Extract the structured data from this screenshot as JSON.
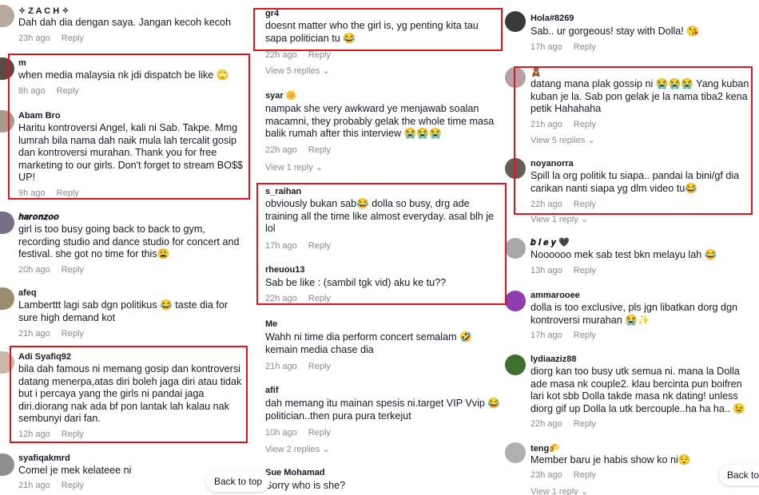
{
  "left": [
    {
      "user": "✧ Z A C H ✧",
      "text": "Dah dah dia dengan saya. Jangan kecoh kecoh",
      "time": "23h ago",
      "reply": "Reply"
    },
    {
      "user": "m",
      "text": "when media malaysia nk jdi dispatch be like 🙄",
      "time": "8h ago",
      "reply": "Reply"
    },
    {
      "user": "Abam Bro",
      "text": "Haritu kontroversi Angel, kali ni Sab. Takpe. Mmg lumrah bila nama dah naik mula lah tercalit gosip dan kontroversi murahan. Thank you for free marketing to our girls. Don't forget to stream BO$$ UP!",
      "time": "9h ago",
      "reply": "Reply"
    },
    {
      "user": "𝒉𝒂𝒓𝒐𝒏𝒛𝒐𝒐",
      "text": "girl is too busy going back to back to gym, recording studio and dance studio for concert and festival. she got no time for this😩",
      "time": "20h ago",
      "reply": "Reply"
    },
    {
      "user": "afeq",
      "text": "Lamberttt lagi sab dgn politikus 😂 taste dia for sure high demand kot",
      "time": "21h ago",
      "reply": "Reply"
    },
    {
      "user": "Adi Syafiq92",
      "text": "bila dah famous ni memang gosip dan kontroversi datang menerpa,atas diri boleh jaga diri atau tidak but i percaya yang the girls ni pandai jaga diri.diorang nak ada bf pon lantak lah kalau nak sembunyi dari fan.",
      "time": "12h ago",
      "reply": "Reply"
    },
    {
      "user": "syafiqakmrd",
      "text": "Comel je mek kelateee ni",
      "time": "21h ago",
      "reply": "Reply"
    }
  ],
  "middle": [
    {
      "user": "gr4",
      "text": "doesnt matter who the girl is, yg penting kita tau sapa politician tu 😂",
      "time": "22h ago",
      "reply": "Reply",
      "more": "View 5 replies"
    },
    {
      "user": "syar 🌼",
      "text": "nampak she very awkward ye menjawab soalan macamni, they probably gelak the whole time masa balik rumah after this interview 😭😭😭",
      "time": "22h ago",
      "reply": "Reply",
      "more": "View 1 reply"
    },
    {
      "user": "s_raihan",
      "text": "obviously bukan sab😂 dolla so busy, drg ade training all the time like almost everyday. asal blh je lol",
      "time": "17h ago",
      "reply": "Reply"
    },
    {
      "user": "rheuou13",
      "text": "Sab be like : (sambil tgk vid) aku ke tu??",
      "time": "22h ago",
      "reply": "Reply"
    },
    {
      "user": "Me",
      "text": "Wahh ni time dia perform concert semalam 🤣 kemain media chase dia",
      "time": "21h ago",
      "reply": "Reply"
    },
    {
      "user": "afif",
      "text": "dah memang itu mainan spesis ni.target VIP Vvip 😂 politician..then pura pura terkejut",
      "time": "10h ago",
      "reply": "Reply",
      "more": "View 2 replies"
    },
    {
      "user": "Sue Mohamad",
      "text": "Sorry who is she?",
      "time": "",
      "reply": ""
    }
  ],
  "right": [
    {
      "user": "Hola#8269",
      "text": "Sab.. ur gorgeous! stay with Dolla! 😘",
      "time": "17h ago",
      "reply": "Reply"
    },
    {
      "user": "🧸",
      "text": "datang mana plak gossip ni 😭😭😭 Yang kuban kuban je la. Sab pon gelak je la nama tiba2 kena petik Hahahaha",
      "time": "21h ago",
      "reply": "Reply",
      "more": "View 5 replies"
    },
    {
      "user": "noyanorra",
      "text": "Spill la org politik tu siapa.. pandai la bini/gf dia carikan nanti siapa yg dlm video tu😂",
      "time": "22h ago",
      "reply": "Reply",
      "more": "View 1 reply"
    },
    {
      "user": "𝒃 𝒊 𝒆 𝒚 🖤",
      "text": "Noooooo mek sab test bkn melayu lah 😂",
      "time": "13h ago",
      "reply": "Reply"
    },
    {
      "user": "ammarooee",
      "text": "dolla is too exclusive, pls jgn libatkan dorg dgn kontroversi murahan 😭✨",
      "time": "17h ago",
      "reply": "Reply"
    },
    {
      "user": "lydiaaziz88",
      "text": "diorg kan too busy utk semua ni. mana la Dolla ade masa nk couple2. klau bercinta pun boifren lari kot sbb Dolla takde masa nk dating! unless diorg gif up Dolla la utk bercouple..ha ha ha.. 😉",
      "time": "22h ago",
      "reply": "Reply"
    },
    {
      "user": "teng🌮",
      "text": "Member baru je habis show ko ni😌",
      "time": "23h ago",
      "reply": "Reply",
      "more": "View 1 reply"
    }
  ],
  "back_to_top": "Back to top"
}
